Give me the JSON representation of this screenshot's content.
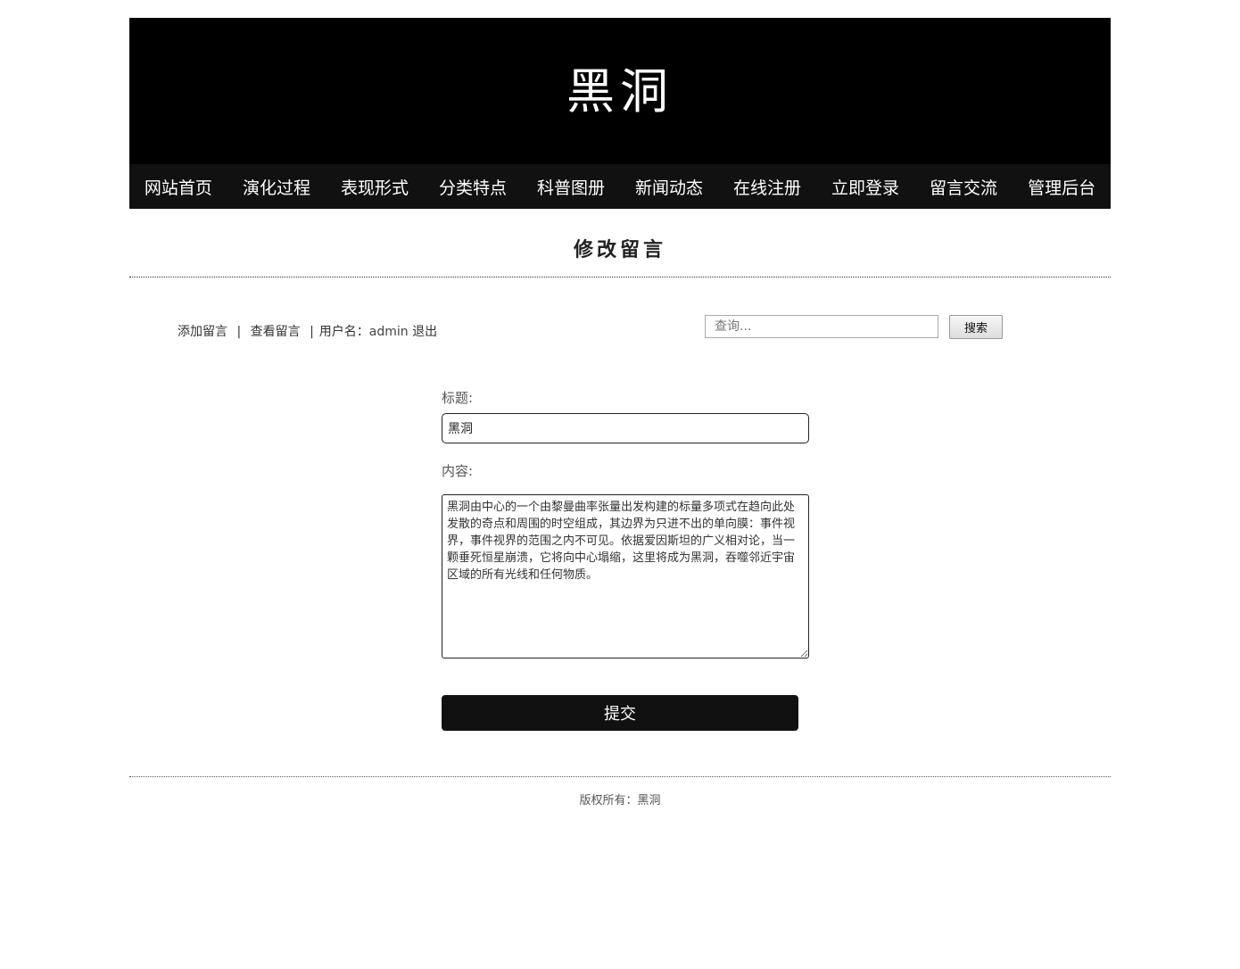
{
  "site": {
    "title": "黑洞"
  },
  "nav": {
    "items": [
      {
        "label": "网站首页"
      },
      {
        "label": "演化过程"
      },
      {
        "label": "表现形式"
      },
      {
        "label": "分类特点"
      },
      {
        "label": "科普图册"
      },
      {
        "label": "新闻动态"
      },
      {
        "label": "在线注册"
      },
      {
        "label": "立即登录"
      },
      {
        "label": "留言交流"
      },
      {
        "label": "管理后台"
      }
    ]
  },
  "page": {
    "heading": "修改留言"
  },
  "toolbar": {
    "add_link": "添加留言",
    "sep1": "|",
    "view_link": "查看留言",
    "sep2": "|",
    "username_label": "用户名：",
    "username": "admin",
    "logout_link": "退出",
    "search_placeholder": "查询...",
    "search_button": "搜索"
  },
  "form": {
    "title_label": "标题:",
    "title_value": "黑洞",
    "content_label": "内容:",
    "content_value": "黑洞由中心的一个由黎曼曲率张量出发构建的标量多项式在趋向此处发散的奇点和周围的时空组成，其边界为只进不出的单向膜：事件视界，事件视界的范围之内不可见。依据爱因斯坦的广义相对论，当一颗垂死恒星崩溃，它将向中心塌缩，这里将成为黑洞，吞噬邻近宇宙区域的所有光线和任何物质。",
    "submit_label": "提交"
  },
  "footer": {
    "copyright": "版权所有：黑洞"
  }
}
